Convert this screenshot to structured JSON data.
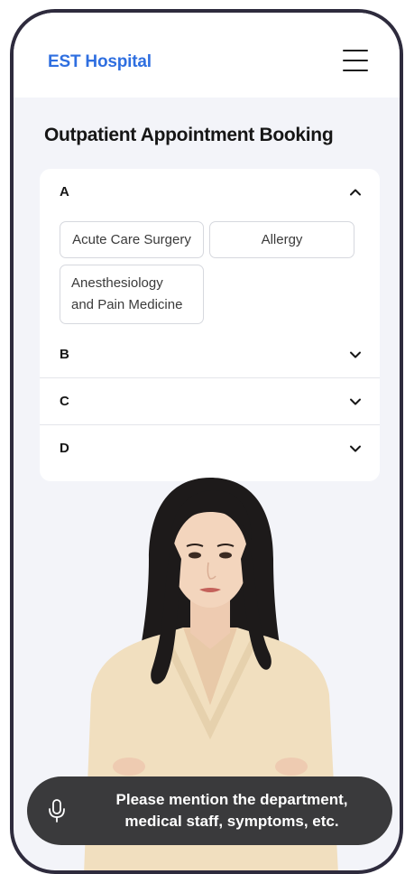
{
  "header": {
    "brand": "EST Hospital",
    "menu_icon": "hamburger-menu-icon"
  },
  "page": {
    "title": "Outpatient Appointment Booking"
  },
  "accordion": {
    "sections": [
      {
        "letter": "A",
        "expanded": true,
        "chevron_icon": "chevron-up-icon",
        "departments": [
          {
            "line1": "Acute Care Surgery"
          },
          {
            "line1": "Allergy"
          },
          {
            "line1": "Anesthesiology",
            "line2": "and Pain Medicine"
          }
        ]
      },
      {
        "letter": "B",
        "expanded": false,
        "chevron_icon": "chevron-down-icon"
      },
      {
        "letter": "C",
        "expanded": false,
        "chevron_icon": "chevron-down-icon"
      },
      {
        "letter": "D",
        "expanded": false,
        "chevron_icon": "chevron-down-icon"
      }
    ]
  },
  "voice_prompt": {
    "icon": "microphone-icon",
    "line1": "Please mention the department,",
    "line2": "medical staff, symptoms, etc."
  },
  "colors": {
    "brand": "#2f6fe0",
    "background": "#f3f4f9",
    "voice_bar": "#3a3a3c"
  }
}
